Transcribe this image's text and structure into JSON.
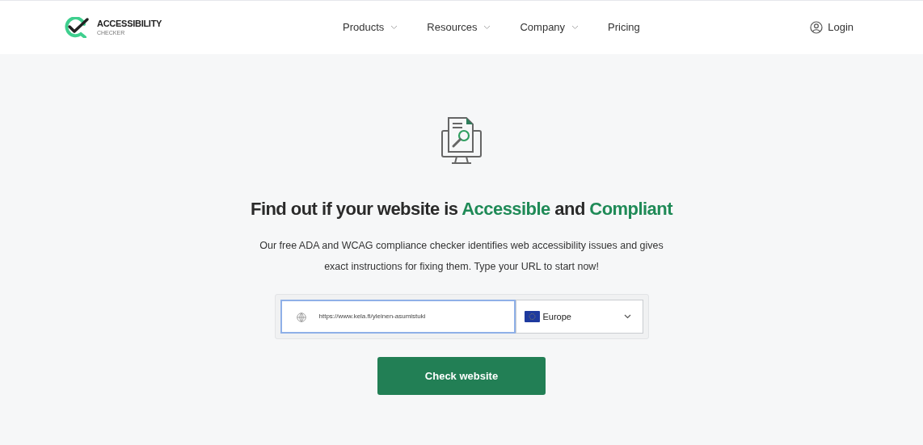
{
  "logo": {
    "title": "ACCESSIBILITY",
    "subtitle": "CHECKER"
  },
  "nav": [
    {
      "label": "Products",
      "has_menu": true
    },
    {
      "label": "Resources",
      "has_menu": true
    },
    {
      "label": "Company",
      "has_menu": true
    },
    {
      "label": "Pricing",
      "has_menu": false
    }
  ],
  "login": "Login",
  "headline": [
    {
      "text": "Find out if your website is",
      "accent": false
    },
    {
      "text": "Accessible",
      "accent": true
    },
    {
      "text": "and",
      "accent": false
    },
    {
      "text": "Compliant",
      "accent": true
    }
  ],
  "description": [
    "Our free ADA and WCAG compliance checker identifies web accessibility issues and gives",
    "exact instructions for fixing them. Type your URL to start now!"
  ],
  "url_field": {
    "value": "https://www.kela.fi/yleinen-asumistuki"
  },
  "region_select": {
    "value": "Europe"
  },
  "submit": "Check website"
}
